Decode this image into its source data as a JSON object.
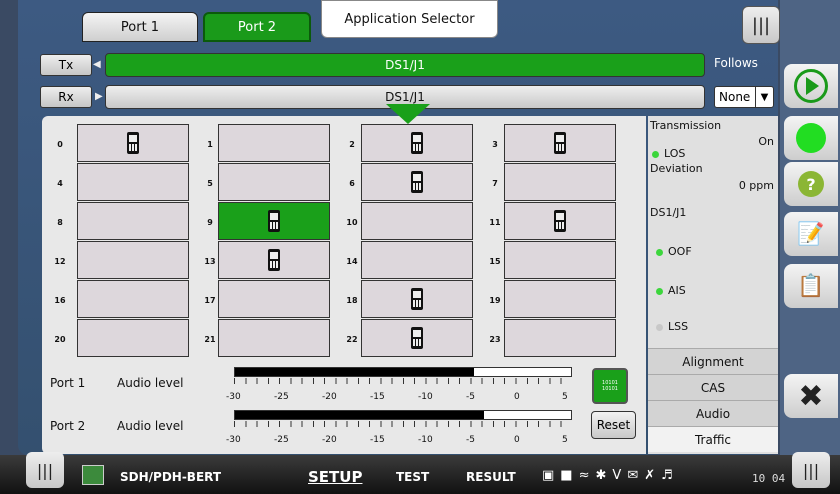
{
  "tabs": {
    "port1": "Port 1",
    "port2": "Port 2",
    "app_selector": "Application Selector"
  },
  "menu_icon": "|||",
  "signal": {
    "tx_label": "Tx",
    "rx_label": "Rx",
    "tx_value": "DS1/J1",
    "rx_value": "DS1/J1",
    "follows_label": "Follows",
    "follows_value": "None"
  },
  "slots": [
    {
      "n": "0",
      "phone": true,
      "active": false
    },
    {
      "n": "1",
      "phone": false,
      "active": false
    },
    {
      "n": "2",
      "phone": true,
      "active": false
    },
    {
      "n": "3",
      "phone": true,
      "active": false
    },
    {
      "n": "4",
      "phone": false,
      "active": false
    },
    {
      "n": "5",
      "phone": false,
      "active": false
    },
    {
      "n": "6",
      "phone": true,
      "active": false
    },
    {
      "n": "7",
      "phone": false,
      "active": false
    },
    {
      "n": "8",
      "phone": false,
      "active": false
    },
    {
      "n": "9",
      "phone": true,
      "active": true
    },
    {
      "n": "10",
      "phone": false,
      "active": false
    },
    {
      "n": "11",
      "phone": true,
      "active": false
    },
    {
      "n": "12",
      "phone": false,
      "active": false
    },
    {
      "n": "13",
      "phone": true,
      "active": false
    },
    {
      "n": "14",
      "phone": false,
      "active": false
    },
    {
      "n": "15",
      "phone": false,
      "active": false
    },
    {
      "n": "16",
      "phone": false,
      "active": false
    },
    {
      "n": "17",
      "phone": false,
      "active": false
    },
    {
      "n": "18",
      "phone": true,
      "active": false
    },
    {
      "n": "19",
      "phone": false,
      "active": false
    },
    {
      "n": "20",
      "phone": false,
      "active": false
    },
    {
      "n": "21",
      "phone": false,
      "active": false
    },
    {
      "n": "22",
      "phone": true,
      "active": false
    },
    {
      "n": "23",
      "phone": false,
      "active": false
    }
  ],
  "audio": {
    "port1_label": "Port 1",
    "port2_label": "Port 2",
    "level_label": "Audio level",
    "port1_level_fraction": 0.71,
    "port2_level_fraction": 0.74,
    "scale": [
      "-30",
      "-25",
      "-20",
      "-15",
      "-10",
      "-5",
      "0",
      "5"
    ],
    "binary_text": "10101 10101",
    "reset_label": "Reset"
  },
  "side": {
    "transmission_label": "Transmission",
    "transmission_value": "On",
    "los_label": "LOS",
    "deviation_label": "Deviation",
    "deviation_value": "0 ppm",
    "ds1_label": "DS1/J1",
    "oof_label": "OOF",
    "ais_label": "AIS",
    "lss_label": "LSS",
    "tabs": [
      "Alignment",
      "CAS",
      "Audio",
      "Traffic"
    ]
  },
  "bottom": {
    "app_name": "SDH/PDH-BERT",
    "setup": "SETUP",
    "test": "TEST",
    "result": "RESULT",
    "clock": "10 04"
  },
  "colors": {
    "accent_green": "#1aa01a",
    "panel_bg": "#3d5a82"
  }
}
